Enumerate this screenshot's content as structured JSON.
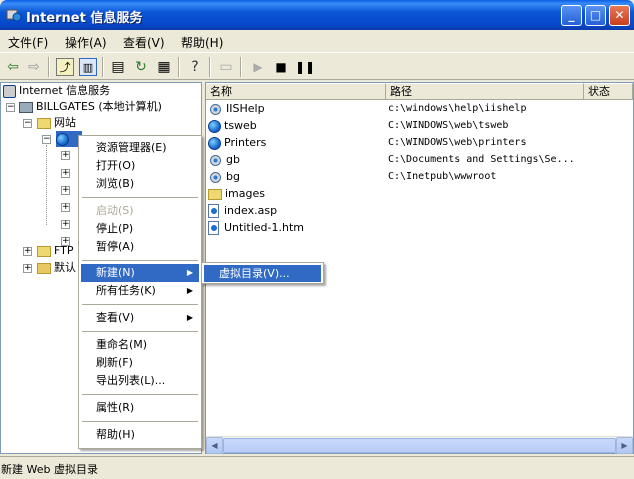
{
  "window": {
    "title": "Internet 信息服务",
    "minimize": "_",
    "maximize": "□",
    "close": "✕"
  },
  "menubar": {
    "items": [
      "文件(F)",
      "操作(A)",
      "查看(V)",
      "帮助(H)"
    ]
  },
  "tree": {
    "root": "Internet 信息服务",
    "computer": "BILLGATES (本地计算机)",
    "websites": "网站",
    "ftp": "FTP",
    "default_smtp": "默认"
  },
  "list": {
    "headers": [
      "名称",
      "路径",
      "状态"
    ],
    "rows": [
      {
        "name": "IISHelp",
        "path": "c:\\windows\\help\\iishelp",
        "icon": "gear"
      },
      {
        "name": "tsweb",
        "path": "C:\\WINDOWS\\web\\tsweb",
        "icon": "gear"
      },
      {
        "name": "Printers",
        "path": "C:\\WINDOWS\\web\\printers",
        "icon": "gear"
      },
      {
        "name": "gb",
        "path": "C:\\Documents and Settings\\Se...",
        "icon": "gear"
      },
      {
        "name": "bg",
        "path": "C:\\Inetpub\\wwwroot",
        "icon": "gear"
      },
      {
        "name": "images",
        "path": "",
        "icon": "folder"
      },
      {
        "name": "index.asp",
        "path": "",
        "icon": "file"
      },
      {
        "name": "Untitled-1.htm",
        "path": "",
        "icon": "file"
      }
    ]
  },
  "context_menu": {
    "items": [
      {
        "label": "资源管理器(E)",
        "disabled": false
      },
      {
        "label": "打开(O)",
        "disabled": false
      },
      {
        "label": "浏览(B)",
        "disabled": false
      },
      {
        "label": "启动(S)",
        "disabled": true
      },
      {
        "label": "停止(P)",
        "disabled": false
      },
      {
        "label": "暂停(A)",
        "disabled": false
      },
      {
        "label": "新建(N)",
        "disabled": false,
        "submenu": true,
        "selected": true
      },
      {
        "label": "所有任务(K)",
        "disabled": false,
        "submenu": true
      },
      {
        "label": "查看(V)",
        "disabled": false,
        "submenu": true
      },
      {
        "label": "重命名(M)",
        "disabled": false
      },
      {
        "label": "刷新(F)",
        "disabled": false
      },
      {
        "label": "导出列表(L)...",
        "disabled": false
      },
      {
        "label": "属性(R)",
        "disabled": false
      },
      {
        "label": "帮助(H)",
        "disabled": false
      }
    ]
  },
  "submenu": {
    "item": "虚拟目录(V)..."
  },
  "status": {
    "text": "新建 Web 虚拟目录"
  },
  "colors": {
    "titlebar": "#0b58d8",
    "highlight": "#316ac5",
    "chrome": "#ece9d8"
  }
}
